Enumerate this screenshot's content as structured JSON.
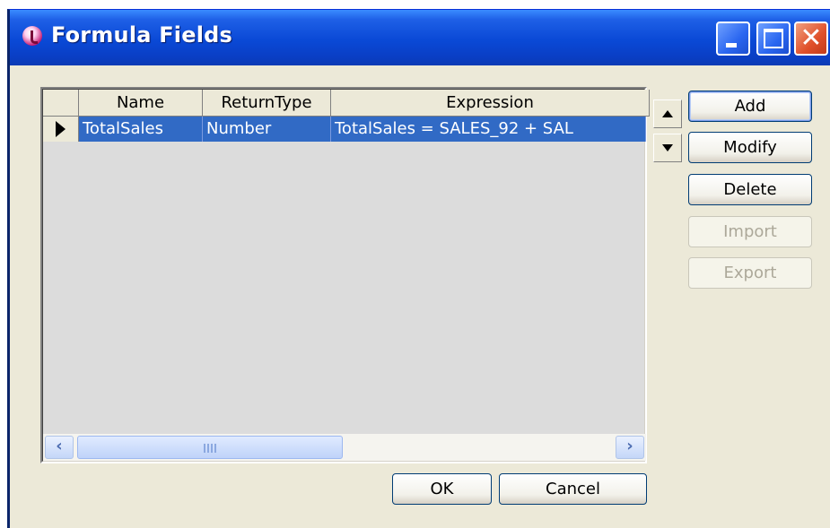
{
  "window": {
    "title": "Formula Fields"
  },
  "grid": {
    "columns": [
      "Name",
      "ReturnType",
      "Expression"
    ],
    "rows": [
      {
        "name": "TotalSales",
        "return_type": "Number",
        "expression": "TotalSales = SALES_92 + SAL"
      }
    ]
  },
  "buttons": {
    "add": "Add",
    "modify": "Modify",
    "delete": "Delete",
    "import": "Import",
    "export": "Export",
    "ok": "OK",
    "cancel": "Cancel"
  },
  "icons": {
    "app": "formula-app-icon",
    "minimize": "minimize-icon",
    "maximize": "maximize-icon",
    "close": "close-icon",
    "move_up": "arrow-up-icon",
    "move_down": "arrow-down-icon",
    "scroll_left": "scroll-left-icon",
    "scroll_right": "scroll-right-icon",
    "row_indicator": "current-row-icon"
  },
  "colors": {
    "title_bar": "#0A49D6",
    "selection": "#316AC5",
    "dialog_bg": "#ECE9D8",
    "close_button": "#E0502A"
  }
}
